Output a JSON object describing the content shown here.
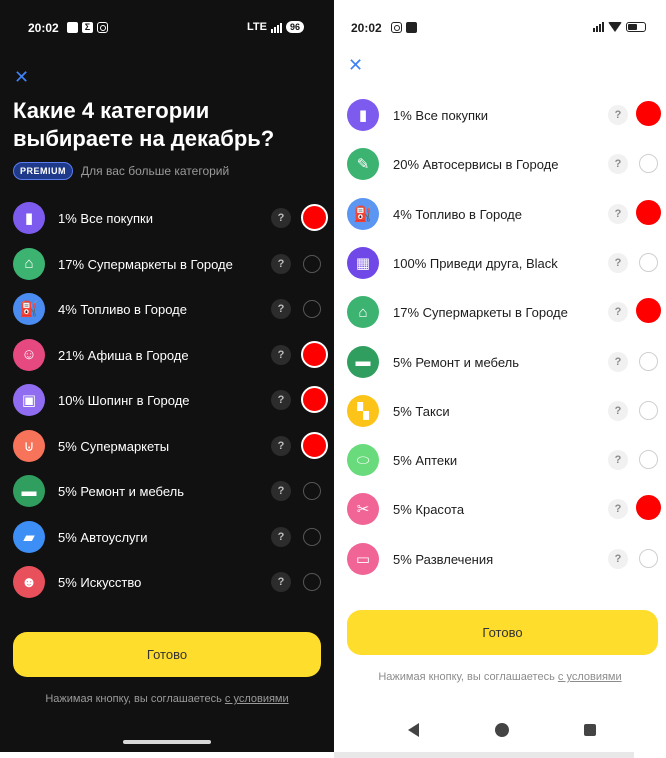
{
  "left_screen": {
    "status": {
      "time": "20:02",
      "network": "LTE",
      "battery": "96"
    },
    "title": "Какие 4 категории выбираете на декабрь?",
    "premium_badge": "PREMIUM",
    "premium_text": "Для вас больше категорий",
    "categories": [
      {
        "label": "1% Все покупки",
        "icon": "bag-icon",
        "color": "#7e5bef",
        "selected": true
      },
      {
        "label": "17% Супермаркеты в Городе",
        "icon": "basket-icon",
        "color": "#3cb371",
        "selected": false
      },
      {
        "label": "4% Топливо в Городе",
        "icon": "fuel-icon",
        "color": "#4a8cf0",
        "selected": false
      },
      {
        "label": "21% Афиша в Городе",
        "icon": "mask-icon",
        "color": "#e64980",
        "selected": true
      },
      {
        "label": "10% Шопинг в Городе",
        "icon": "shopping-bag-icon",
        "color": "#8f6cf0",
        "selected": true
      },
      {
        "label": "5% Супермаркеты",
        "icon": "cart-icon",
        "color": "#f7735a",
        "selected": true
      },
      {
        "label": "5% Ремонт и мебель",
        "icon": "paint-roller-icon",
        "color": "#2f9e5e",
        "selected": false
      },
      {
        "label": "5% Автоуслуги",
        "icon": "car-icon",
        "color": "#3d8ef5",
        "selected": false
      },
      {
        "label": "5% Искусство",
        "icon": "theater-icon",
        "color": "#e8505b",
        "selected": false
      }
    ],
    "help_glyph": "?",
    "done_label": "Готово",
    "terms_prefix": "Нажимая кнопку, вы соглашаетесь",
    "terms_link": "с условиями"
  },
  "right_screen": {
    "status": {
      "time": "20:02"
    },
    "categories": [
      {
        "label": "1% Все покупки",
        "icon": "bag-icon",
        "color": "#7e5bef",
        "selected": true
      },
      {
        "label": "20% Автосервисы в Городе",
        "icon": "wrench-icon",
        "color": "#3cb371",
        "selected": false
      },
      {
        "label": "4% Топливо в Городе",
        "icon": "fuel-icon",
        "color": "#5a96f2",
        "selected": true
      },
      {
        "label": "100% Приведи друга, Black",
        "icon": "gift-icon",
        "color": "#7048e8",
        "selected": false
      },
      {
        "label": "17% Супермаркеты в Городе",
        "icon": "basket-icon",
        "color": "#3cb371",
        "selected": true
      },
      {
        "label": "5% Ремонт и мебель",
        "icon": "paint-roller-icon",
        "color": "#2f9e5e",
        "selected": false
      },
      {
        "label": "5% Такси",
        "icon": "taxi-icon",
        "color": "#fcc419",
        "selected": false
      },
      {
        "label": "5% Аптеки",
        "icon": "pill-icon",
        "color": "#69db7c",
        "selected": false
      },
      {
        "label": "5% Красота",
        "icon": "scissors-icon",
        "color": "#f06595",
        "selected": true
      },
      {
        "label": "5% Развлечения",
        "icon": "gamepad-icon",
        "color": "#f06595",
        "selected": false
      }
    ],
    "help_glyph": "?",
    "done_label": "Готово",
    "terms_prefix": "Нажимая кнопку, вы соглашаетесь",
    "terms_link": "с условиями"
  },
  "icon_glyphs": {
    "bag-icon": "▮",
    "basket-icon": "⌂",
    "fuel-icon": "⛽",
    "mask-icon": "☺",
    "shopping-bag-icon": "▣",
    "cart-icon": "⊍",
    "paint-roller-icon": "▬",
    "car-icon": "▰",
    "theater-icon": "☻",
    "wrench-icon": "✎",
    "gift-icon": "▦",
    "taxi-icon": "▚",
    "pill-icon": "⬭",
    "scissors-icon": "✂",
    "gamepad-icon": "▭"
  }
}
